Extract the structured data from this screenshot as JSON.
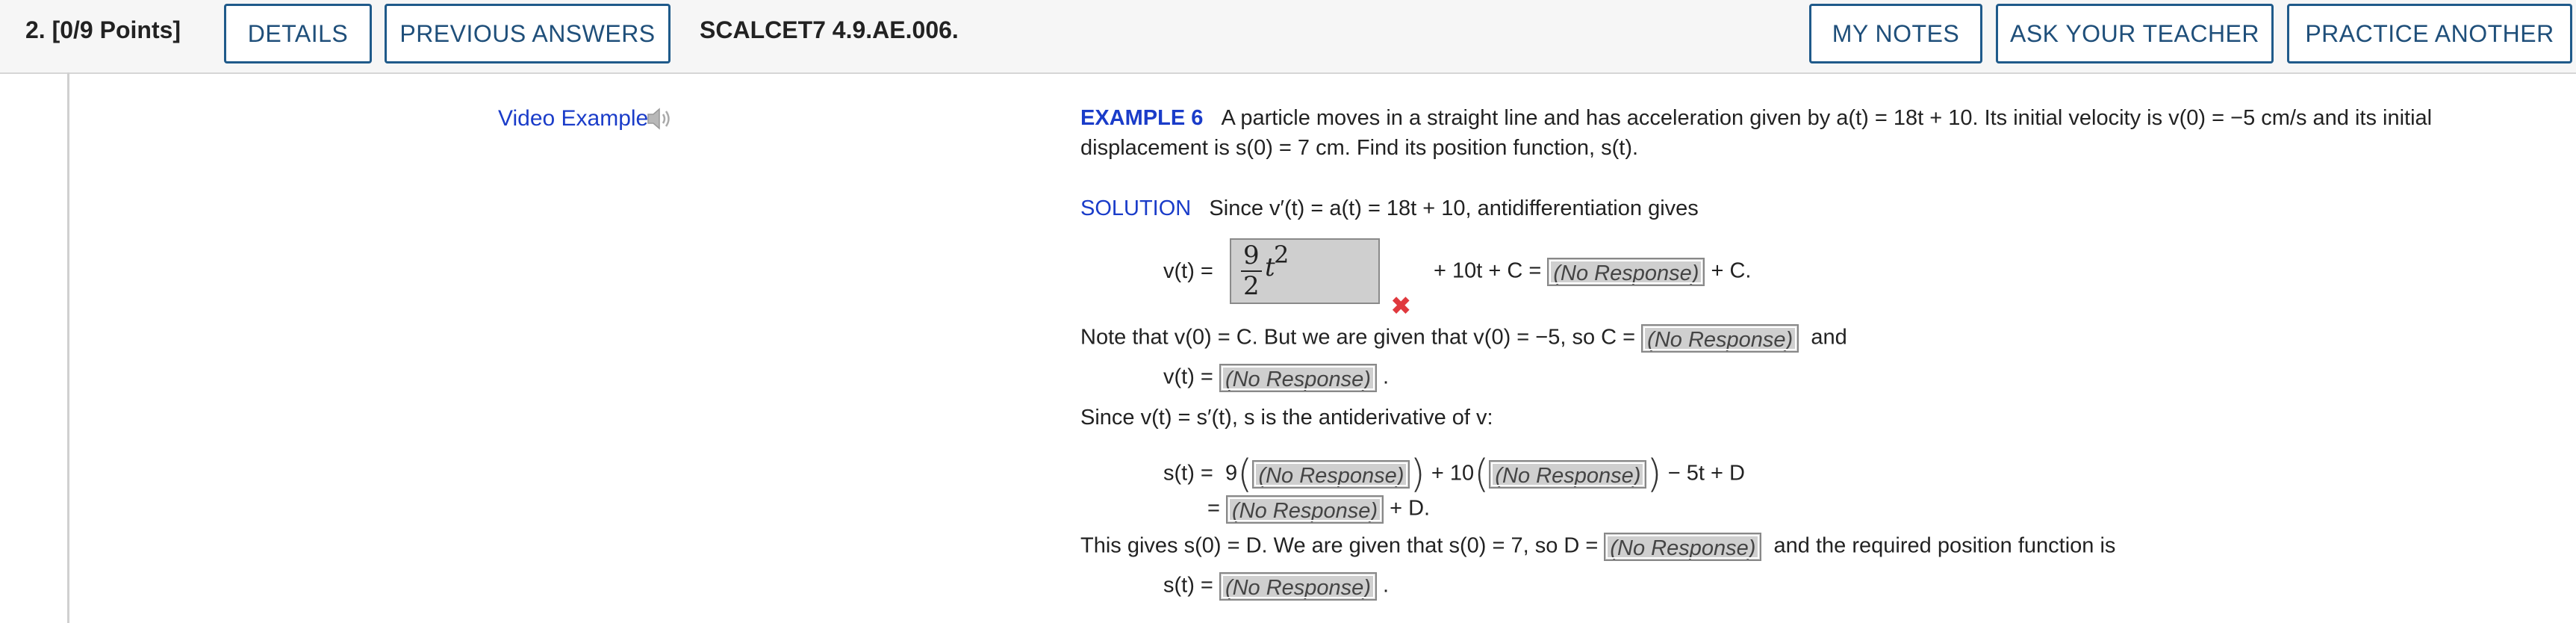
{
  "header": {
    "question_number": "2.",
    "points": "[0/9 Points]",
    "details_label": "DETAILS",
    "previous_answers_label": "PREVIOUS ANSWERS",
    "question_code": "SCALCET7 4.9.AE.006.",
    "my_notes_label": "MY NOTES",
    "ask_teacher_label": "ASK YOUR TEACHER",
    "practice_another_label": "PRACTICE ANOTHER"
  },
  "video": {
    "label": "Video Example",
    "icon": "speaker-icon"
  },
  "example": {
    "label": "EXAMPLE 6",
    "statement_line1": "A particle moves in a straight line and has acceleration given by a(t) = 18t + 10. Its initial velocity is v(0) = −5 cm/s and its initial",
    "statement_line2": "displacement is s(0) = 7 cm. Find its position function, s(t)."
  },
  "solution": {
    "label": "SOLUTION",
    "intro": "Since v′(t) = a(t) = 18t + 10, antidifferentiation gives",
    "vt_label": "v(t) =",
    "entered_answer": {
      "numerator": "9",
      "denominator": "2",
      "variable": "t",
      "exponent": "2"
    },
    "vt_tail_1": "+ 10t + C =",
    "vt_tail_2": "+ C.",
    "note_line": "Note that v(0) = C. But we are given that v(0) = −5, so C =",
    "note_and": "and",
    "vt_label_2": "v(t) =",
    "since_line": "Since v(t) = s′(t), s is the antiderivative of v:",
    "st_label": "s(t) =",
    "st_9": "9",
    "st_plus10": "+ 10",
    "st_tail": "− 5t + D",
    "equals": "=",
    "plus_d": "+ D.",
    "gives_line": "This gives s(0) = D. We are given that s(0) = 7, so D =",
    "gives_tail": "and the required position function is",
    "st_label_2": "s(t) =",
    "period": "."
  },
  "response_placeholder": "(No Response)",
  "status_icon": "incorrect-x-icon",
  "colors": {
    "accent": "#1a3cc9",
    "button_border": "#1f5a8a",
    "incorrect": "#e0393e",
    "response_bg": "#cfcfcf"
  }
}
